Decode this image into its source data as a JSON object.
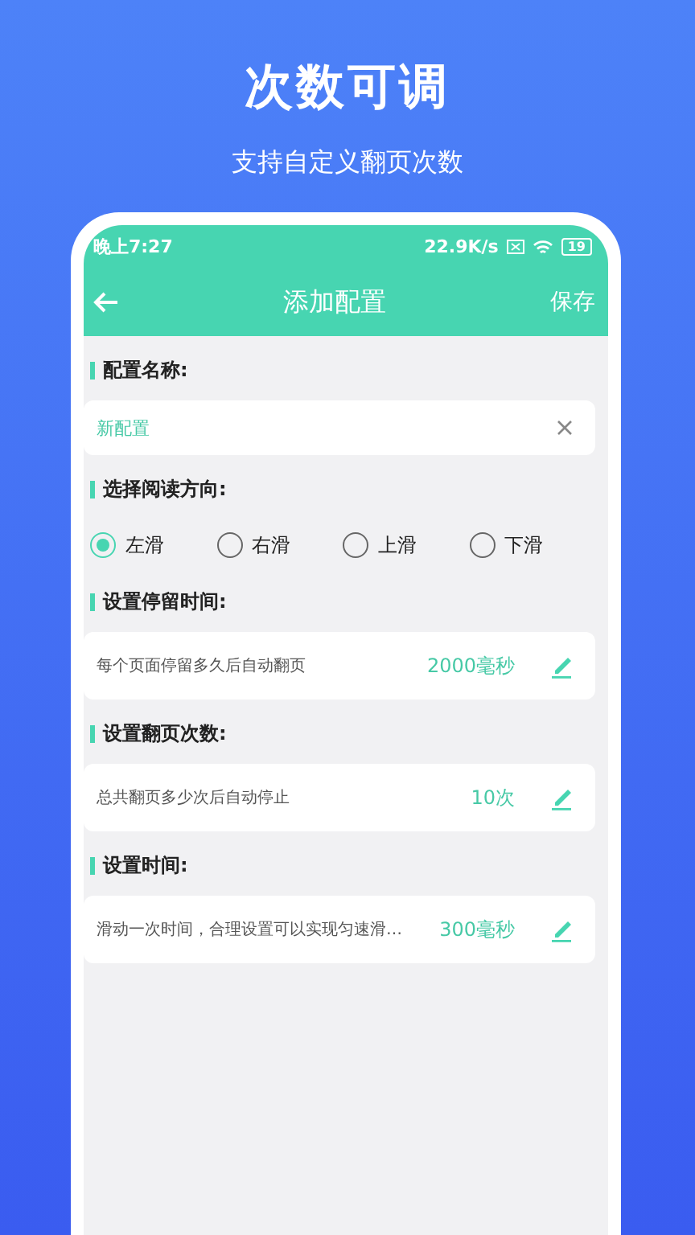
{
  "promo": {
    "title": "次数可调",
    "subtitle": "支持自定义翻页次数"
  },
  "status_bar": {
    "time": "晚上7:27",
    "speed": "22.9K/s",
    "battery": "19"
  },
  "header": {
    "title": "添加配置",
    "action": "保存"
  },
  "name_section": {
    "label": "配置名称:",
    "value": "新配置"
  },
  "direction_section": {
    "label": "选择阅读方向:",
    "options": [
      {
        "label": "左滑",
        "selected": true
      },
      {
        "label": "右滑",
        "selected": false
      },
      {
        "label": "上滑",
        "selected": false
      },
      {
        "label": "下滑",
        "selected": false
      }
    ]
  },
  "settings": [
    {
      "label": "设置停留时间:",
      "description": "每个页面停留多久后自动翻页",
      "value": "2000毫秒"
    },
    {
      "label": "设置翻页次数:",
      "description": "总共翻页多少次后自动停止",
      "value": "10次"
    },
    {
      "label": "设置时间:",
      "description": "滑动一次时间，合理设置可以实现匀速滑…",
      "value": "300毫秒"
    }
  ]
}
